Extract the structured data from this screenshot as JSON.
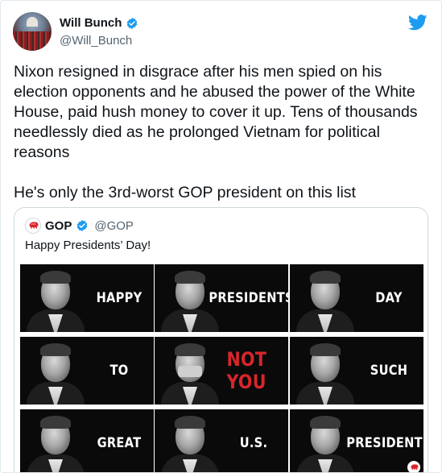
{
  "author": {
    "display_name": "Will Bunch",
    "handle": "@Will_Bunch",
    "avatar_icon": "crowd-capitol-avatar",
    "verified_icon": "verified-badge-icon"
  },
  "platform_icon": "twitter-bird-icon",
  "colors": {
    "twitter_blue": "#1d9bf0",
    "gop_red": "#d7262b",
    "text": "#0f1419",
    "muted": "#536471"
  },
  "tweet_text": "Nixon resigned in disgrace after his men spied on his election opponents and he abused the power of the White House, paid hush money to cover it up. Tens of thousands needlessly died as he prolonged Vietnam for political reasons\n\nHe's only the 3rd-worst GOP president on this list",
  "quoted_tweet": {
    "display_name": "GOP",
    "handle": "@GOP",
    "logo_icon": "gop-elephant-icon",
    "text": "Happy Presidents’ Day!",
    "tiles": [
      {
        "label": "HAPPY",
        "highlight": false,
        "mask": false
      },
      {
        "label": "PRESIDENTS’",
        "highlight": false,
        "mask": false
      },
      {
        "label": "DAY",
        "highlight": false,
        "mask": false
      },
      {
        "label": "TO",
        "highlight": false,
        "mask": false
      },
      {
        "label": "NOT YOU",
        "highlight": true,
        "mask": true
      },
      {
        "label": "SUCH",
        "highlight": false,
        "mask": false
      },
      {
        "label": "GREAT",
        "highlight": false,
        "mask": false
      },
      {
        "label": "U.S.",
        "highlight": false,
        "mask": false
      },
      {
        "label": "PRESIDENTS",
        "highlight": false,
        "mask": false
      }
    ]
  }
}
